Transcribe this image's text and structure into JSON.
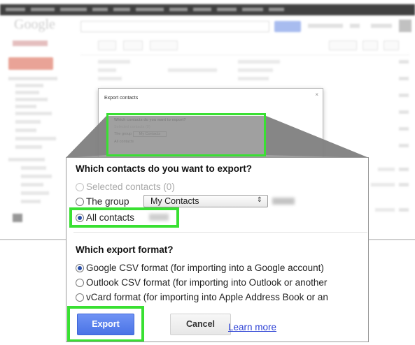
{
  "background_page": {
    "logo": "Google",
    "contacts_label": "Contacts"
  },
  "small_dialog": {
    "title": "Export contacts",
    "close_label": "×",
    "question": "Which contacts do you want to export?",
    "opt_selected": "Selected contacts (0)",
    "opt_group": "The group",
    "group_value": "My Contacts",
    "opt_all": "All contacts"
  },
  "export_dialog": {
    "contacts_question": "Which contacts do you want to export?",
    "contact_options": {
      "selected": "Selected contacts (0)",
      "group": "The group",
      "all": "All contacts"
    },
    "group_select": {
      "value": "My Contacts",
      "arrow": "⇕"
    },
    "format_question": "Which export format?",
    "format_options": [
      "Google CSV format (for importing into a Google account)",
      "Outlook CSV format (for importing into Outlook or another",
      "vCard format (for importing into Apple Address Book or an"
    ],
    "buttons": {
      "export": "Export",
      "cancel": "Cancel",
      "learn_more": "Learn more"
    }
  },
  "colors": {
    "highlight": "#39e032",
    "primary_button": "#4a73e6",
    "link": "#2a3fd4"
  }
}
